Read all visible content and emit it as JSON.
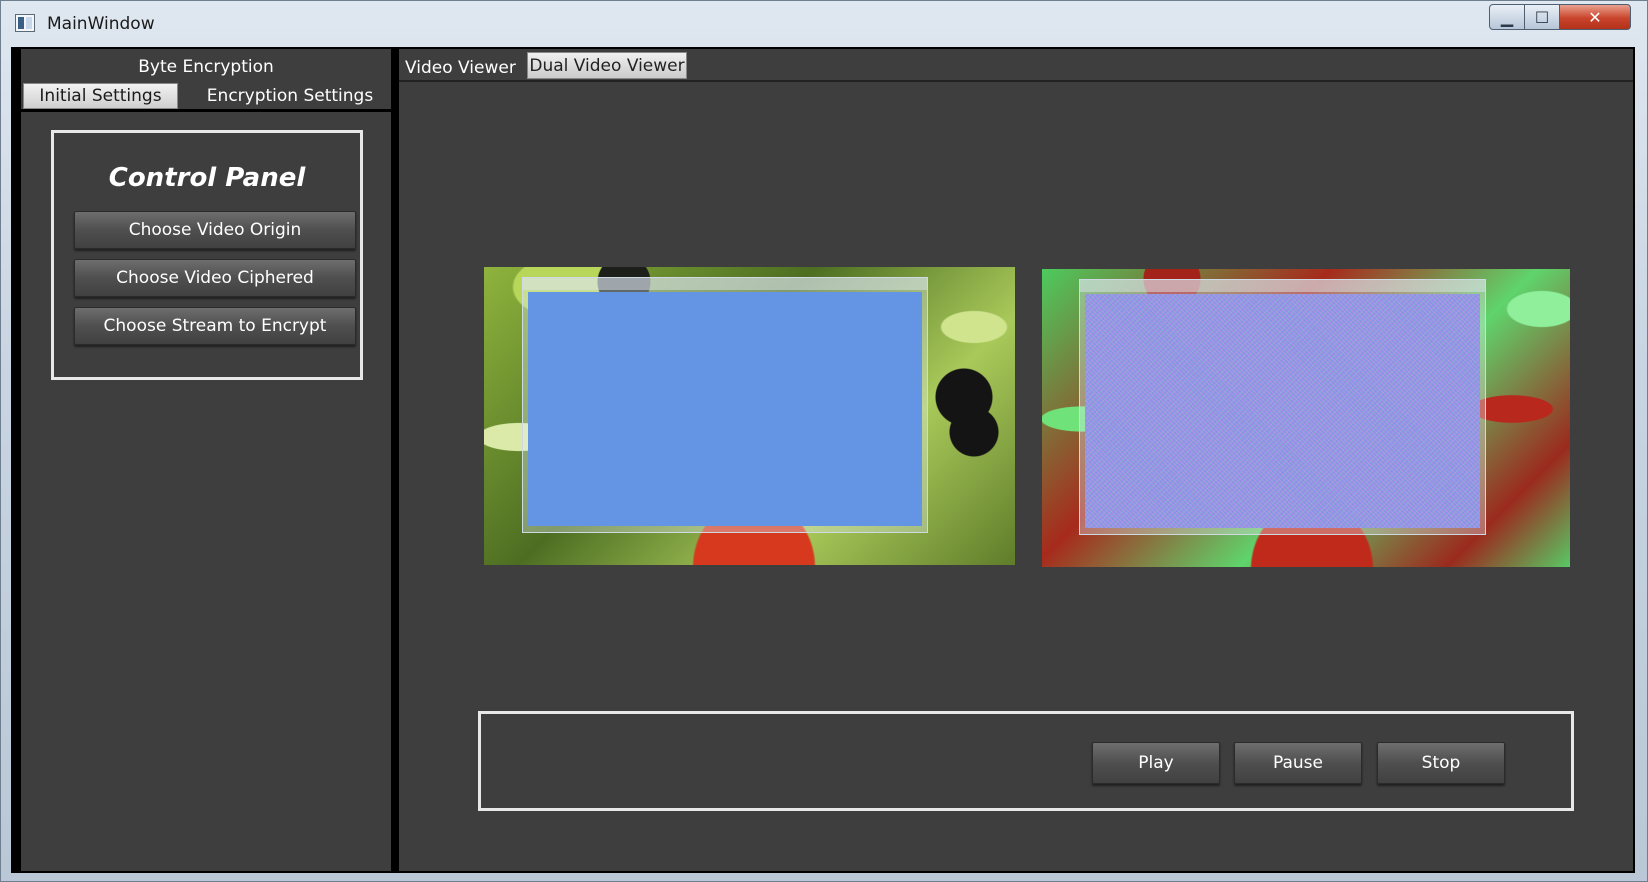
{
  "window": {
    "title": "MainWindow",
    "app_icon": "window-app-icon",
    "minimize_icon": "minimize-icon",
    "maximize_icon": "maximize-icon",
    "close_icon": "close-icon"
  },
  "left": {
    "header": "Byte Encryption",
    "tabs": [
      "Initial Settings",
      "Encryption Settings"
    ],
    "active_tab": "Initial Settings",
    "control_panel": {
      "title": "Control Panel",
      "buttons": [
        "Choose Video Origin",
        "Choose Video Ciphered",
        "Choose Stream to Encrypt"
      ]
    }
  },
  "right": {
    "tabs": [
      "Video Viewer",
      "Dual Video Viewer"
    ],
    "active_tab": "Dual Video Viewer",
    "playback": {
      "play": "Play",
      "pause": "Pause",
      "stop": "Stop"
    }
  },
  "colors": {
    "background": "#3e3e3e",
    "frame": "#000000",
    "border": "#e8e8e8",
    "accent_blue": "#6495e5"
  }
}
